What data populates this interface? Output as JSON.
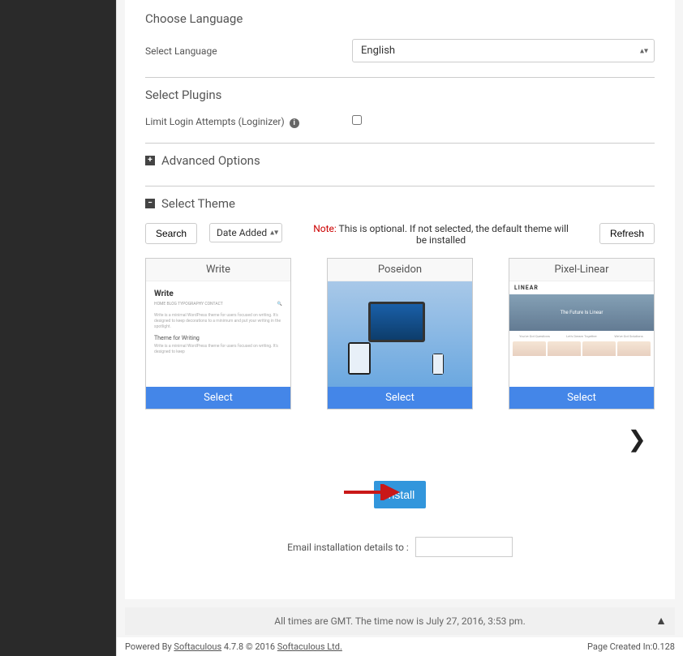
{
  "sections": {
    "choose_language": {
      "title": "Choose Language",
      "field_label": "Select Language",
      "selected": "English"
    },
    "select_plugins": {
      "title": "Select Plugins",
      "plugin_label": "Limit Login Attempts (Loginizer)"
    },
    "advanced_options": {
      "title": "Advanced Options"
    },
    "select_theme": {
      "title": "Select Theme",
      "search_btn": "Search",
      "sort_selected": "Date Added",
      "note_label": "Note:",
      "note_text": " This is optional. If not selected, the default theme will be installed",
      "refresh_btn": "Refresh"
    }
  },
  "themes": [
    {
      "name": "Write",
      "select_label": "Select"
    },
    {
      "name": "Poseidon",
      "select_label": "Select"
    },
    {
      "name": "Pixel-Linear",
      "select_label": "Select"
    }
  ],
  "install": {
    "button": "Install",
    "email_label": "Email installation details to :"
  },
  "footer": {
    "time_text": "All times are GMT. The time now is July 27, 2016, 3:53 pm.",
    "powered_prefix": "Powered By ",
    "powered_link": "Softaculous",
    "version": " 4.7.8 © 2016 ",
    "company_link": "Softaculous Ltd.",
    "page_created_label": "Page Created In:",
    "page_created_value": "0.128"
  },
  "preview": {
    "write": {
      "title": "Write",
      "nav": "HOME   BLOG   TYPOGRAPHY   CONTACT",
      "heading": "Write is a minimal WordPress theme for users focused on writing. It's designed to keep decorations to a minimum and put your writing in the spotlight.",
      "subheading": "Theme for Writing",
      "subtext": "Write is a minimal WordPress theme for users focused on writing. It's designed to keep"
    },
    "pixel": {
      "logo": "LINEAR",
      "hero": "The Future Is Linear",
      "col1": "You've Got Questions",
      "col2": "Let's Dream Together",
      "col3": "We've Got Solutions"
    }
  }
}
